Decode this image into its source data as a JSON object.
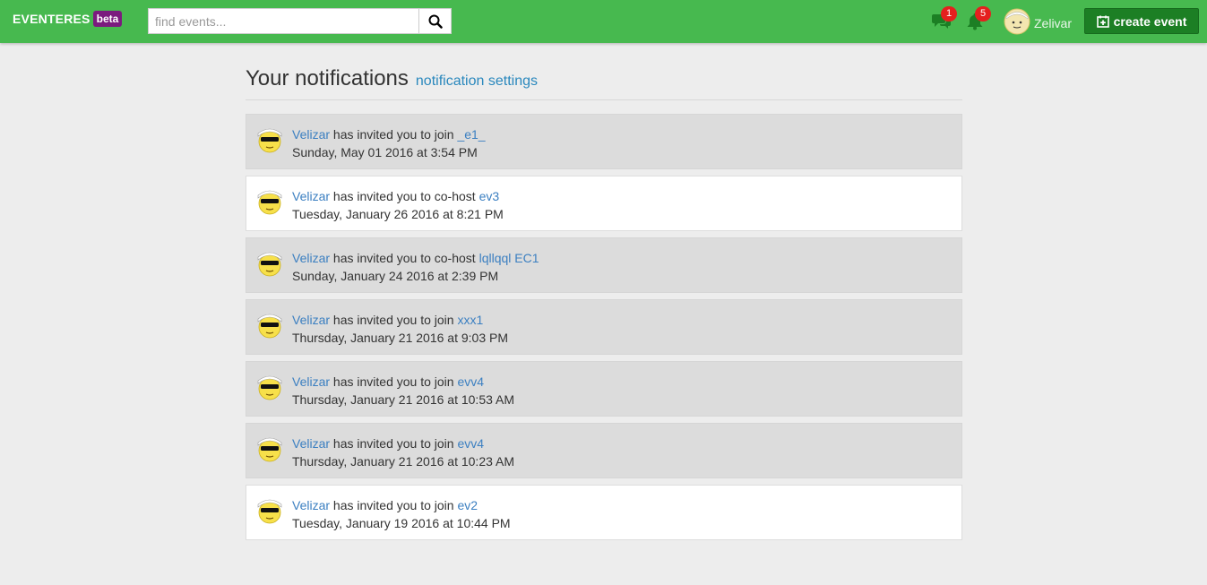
{
  "navbar": {
    "brand": "EVENTERES",
    "beta": "beta",
    "search_placeholder": "find events...",
    "messages_count": "1",
    "alerts_count": "5",
    "username": "Zelivar",
    "create_label": "create event",
    "colors": {
      "bar": "#47b94f",
      "create": "#1c7f24",
      "badge": "#e5201e",
      "beta": "#7b1b7e"
    }
  },
  "page": {
    "title": "Your notifications",
    "settings_link": "notification settings"
  },
  "notifications": [
    {
      "user": "Velizar",
      "action": "has invited you to join",
      "event": "_e1_",
      "time": "Sunday, May 01 2016 at 3:54 PM",
      "read": false
    },
    {
      "user": "Velizar",
      "action": "has invited you to co-host",
      "event": "ev3",
      "time": "Tuesday, January 26 2016 at 8:21 PM",
      "read": true
    },
    {
      "user": "Velizar",
      "action": "has invited you to co-host",
      "event": "lqllqql EC1",
      "time": "Sunday, January 24 2016 at 2:39 PM",
      "read": false
    },
    {
      "user": "Velizar",
      "action": "has invited you to join",
      "event": "xxx1",
      "time": "Thursday, January 21 2016 at 9:03 PM",
      "read": false
    },
    {
      "user": "Velizar",
      "action": "has invited you to join",
      "event": "evv4",
      "time": "Thursday, January 21 2016 at 10:53 AM",
      "read": false
    },
    {
      "user": "Velizar",
      "action": "has invited you to join",
      "event": "evv4",
      "time": "Thursday, January 21 2016 at 10:23 AM",
      "read": false
    },
    {
      "user": "Velizar",
      "action": "has invited you to join",
      "event": "ev2",
      "time": "Tuesday, January 19 2016 at 10:44 PM",
      "read": true
    }
  ]
}
